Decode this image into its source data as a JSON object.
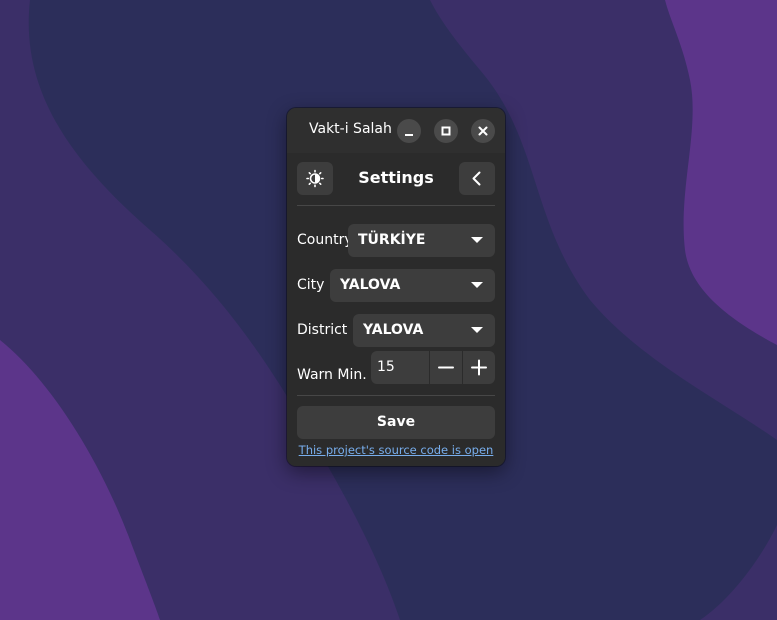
{
  "colors": {
    "wallpaper_base": "#2c2e5a",
    "wallpaper_mid": "#3b2f68",
    "wallpaper_accent": "#5c358a",
    "window_bg": "#2b2b2b",
    "control_bg": "#3d3d3d",
    "link": "#78aeed"
  },
  "window": {
    "title": "Vakt-i Salah",
    "buttons": {
      "minimize": "minimize-icon",
      "maximize": "maximize-icon",
      "close": "close-icon"
    }
  },
  "header": {
    "title": "Settings",
    "theme_icon": "brightness-icon",
    "back_icon": "chevron-left-icon"
  },
  "form": {
    "country": {
      "label": "Country",
      "value": "TÜRKİYE"
    },
    "city": {
      "label": "City",
      "value": "YALOVA"
    },
    "district": {
      "label": "District",
      "value": "YALOVA"
    },
    "warn": {
      "label": "Warn Min.",
      "value": "15",
      "decrement_icon": "minus-icon",
      "increment_icon": "plus-icon"
    }
  },
  "actions": {
    "save_label": "Save",
    "source_link": "This project's source code is open"
  }
}
